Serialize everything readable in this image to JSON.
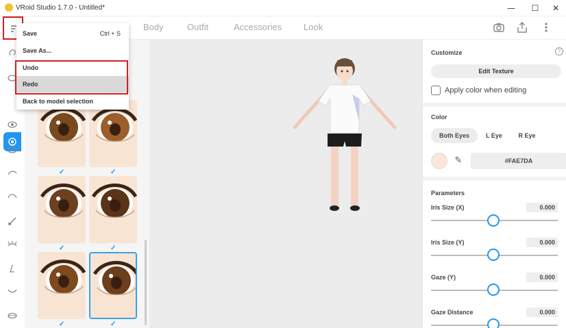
{
  "window": {
    "title": "VRoid Studio 1.7.0 - Untitled*",
    "minimize": "—",
    "maximize": "☐",
    "close": "✕"
  },
  "toolbar": {
    "tabs": [
      "Body",
      "Outfit",
      "Accessories",
      "Look"
    ],
    "icons": [
      "camera-icon",
      "share-icon",
      "more-icon"
    ]
  },
  "menu": {
    "items": [
      {
        "label": "Save",
        "shortcut": "Ctrl + S"
      },
      {
        "label": "Save As..."
      },
      {
        "label": "Undo"
      },
      {
        "label": "Redo"
      },
      {
        "label": "Back to model selection"
      }
    ]
  },
  "left_nav": {
    "icons": [
      "ear-icon",
      "eye-icon",
      "iris-icon",
      "eye-outline-icon",
      "eyelid-icon",
      "eyebrow-icon",
      "eyeliner-icon",
      "eyelash-icon",
      "nose-icon",
      "mouth-icon",
      "lips-icon"
    ]
  },
  "presets": {
    "items": [
      {
        "check": "✓",
        "iris": "#7a4a1e"
      },
      {
        "check": "✓",
        "iris": "#9a5f2a"
      },
      {
        "check": "✓",
        "iris": "#6d4120"
      },
      {
        "check": "✓",
        "iris": "#5a3418"
      },
      {
        "check": "✓",
        "iris": "#7d4a1d"
      },
      {
        "check": "✓",
        "iris": "#6b3e1c"
      }
    ]
  },
  "right_panel": {
    "customize_title": "Customize",
    "help": "?",
    "edit_texture": "Edit Texture",
    "apply_color_label": "Apply color when editing",
    "color_title": "Color",
    "eye_tabs": [
      "Both Eyes",
      "L Eye",
      "R Eye"
    ],
    "hex": "#FAE7DA",
    "swatch_color": "#FAE7DA",
    "parameters_title": "Parameters",
    "params": [
      {
        "label": "Iris Size (X)",
        "value": "0.000"
      },
      {
        "label": "Iris Size (Y)",
        "value": "0.000"
      },
      {
        "label": "Gaze (Y)",
        "value": "0.000"
      },
      {
        "label": "Gaze Distance",
        "value": "0.000"
      }
    ]
  },
  "colors": {
    "accent": "#2196f3",
    "highlight": "#d61d1d"
  }
}
